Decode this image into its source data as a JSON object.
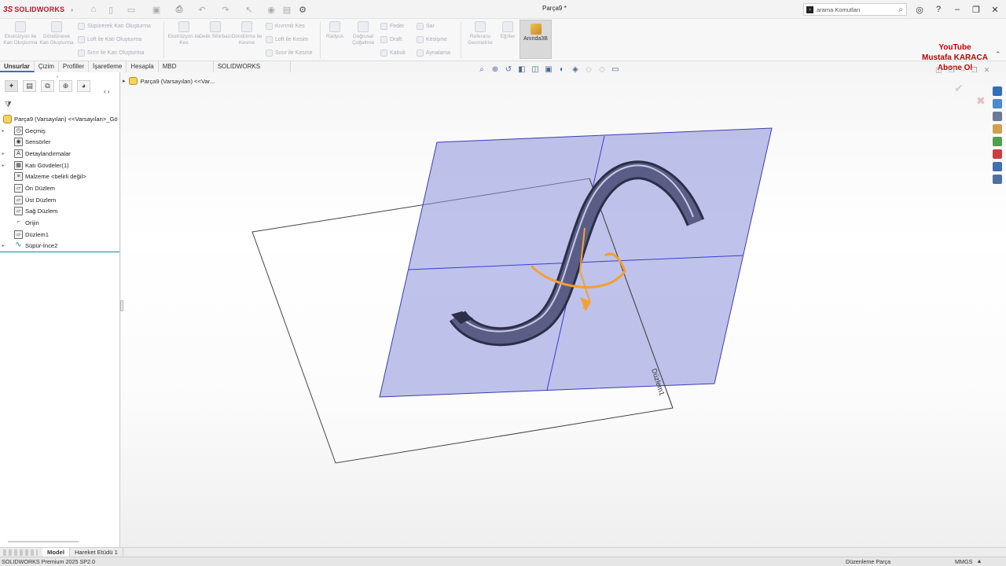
{
  "app": {
    "logo_ds": "3S",
    "logo_name": "SOLIDWORKS",
    "doc_title": "Parça9 *"
  },
  "search": {
    "placeholder": "arama Komutları"
  },
  "ribbon": {
    "features": [
      {
        "label": "Ekstrüzyon ile Katı Oluşturma"
      },
      {
        "label": "Döndürerek Katı Oluşturma"
      }
    ],
    "small_col1": [
      "Süpürerek Katı Oluşturma",
      "Loft ile Katı Oluşturma",
      "Sınır ile Katı Oluşturma"
    ],
    "cuts": [
      {
        "label": "Ekstrüzyon ile Kes"
      },
      {
        "label": "Delik Sihirbazı"
      },
      {
        "label": "Döndürme ile Kesme"
      }
    ],
    "small_col2": [
      "Kıvrımlı Kes",
      "Loft ile Kesim",
      "Sınır ile Kesme"
    ],
    "fillet": {
      "label": "Radyus"
    },
    "pattern": {
      "label": "Doğrusal Çoğaltma"
    },
    "small_col3": [
      "Feder",
      "Draft",
      "Kabuk"
    ],
    "small_col4": [
      "Sar",
      "Kesişme",
      "Aynalama"
    ],
    "ref": {
      "label": "Referans Geometrisi"
    },
    "curves": {
      "label": "Eğriler"
    },
    "instant3d": {
      "label": "Anında3B"
    }
  },
  "promo": {
    "line1": "YouTube",
    "line2": "Mustafa KARACA",
    "line3": "Abone Ol"
  },
  "tabs": [
    {
      "label": "Unsurlar",
      "active": true
    },
    {
      "label": "Çizim"
    },
    {
      "label": "Profiller"
    },
    {
      "label": "İşaretleme"
    },
    {
      "label": "Hesapla"
    },
    {
      "label": "MBD Dimensions"
    },
    {
      "label": "SOLIDWORKS Eklentileri"
    }
  ],
  "breadcrumb": {
    "text": "Parça9 (Varsayılan) <<Var..."
  },
  "tree": {
    "root": "Parça9 (Varsayılan) <<Varsayılan>_Gö",
    "items": [
      {
        "label": "Geçmiş",
        "icon": "history-icon",
        "expand": true
      },
      {
        "label": "Sensörler",
        "icon": "sensor-icon",
        "expand": false
      },
      {
        "label": "Detaylandırmalar",
        "icon": "annotation-icon",
        "expand": true
      },
      {
        "label": "Katı Gövdeler(1)",
        "icon": "solid-bodies-icon",
        "expand": true
      },
      {
        "label": "Malzeme <belirli değil>",
        "icon": "material-icon",
        "expand": false
      },
      {
        "label": "Ön Düzlem",
        "icon": "plane-icon",
        "expand": false
      },
      {
        "label": "Üst Düzlem",
        "icon": "plane-icon",
        "expand": false
      },
      {
        "label": "Sağ Düzlem",
        "icon": "plane-icon",
        "expand": false
      },
      {
        "label": "Orijin",
        "icon": "origin-icon",
        "expand": false
      },
      {
        "label": "Düzlem1",
        "icon": "plane-icon",
        "expand": false
      },
      {
        "label": "Süpür-İnce2",
        "icon": "sweep-icon",
        "expand": true
      }
    ]
  },
  "viewport": {
    "plane_label": "Düzlem1"
  },
  "bottom_tabs": [
    {
      "label": "Model",
      "active": true
    },
    {
      "label": "Hareket Etüdü 1"
    }
  ],
  "status": {
    "version": "SOLIDWORKS Premium 2025 SP2.0",
    "mode": "Düzenleme Parça",
    "units": "MMGS"
  },
  "colors": {
    "accent": "#3a6fc4",
    "brand": "#c8102e",
    "plane": "#8a8fd8",
    "sweep": "#3d3f5e",
    "highlight": "#f5a030"
  }
}
